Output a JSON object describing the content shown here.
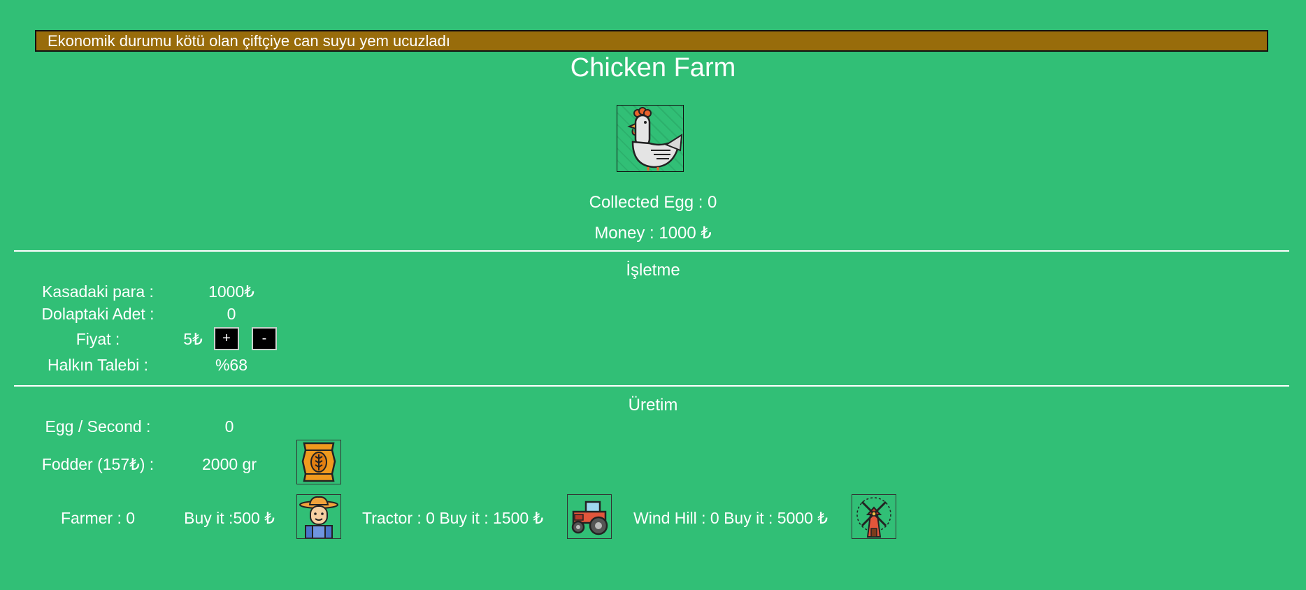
{
  "news_ticker": "Ekonomik durumu kötü olan çiftçiye can suyu yem ucuzladı",
  "title": "Chicken Farm",
  "stats": {
    "collected_egg": "Collected Egg : 0",
    "money": "Money : 1000 ₺"
  },
  "business": {
    "heading": "İşletme",
    "cash_label": "Kasadaki para :",
    "cash_value": "1000₺",
    "stock_label": "Dolaptaki Adet :",
    "stock_value": "0",
    "price_label": "Fiyat :",
    "price_value": "5₺",
    "plus_label": "+",
    "minus_label": "-",
    "demand_label": "Halkın Talebi :",
    "demand_value": "%68"
  },
  "production": {
    "heading": "Üretim",
    "eps_label": "Egg / Second :",
    "eps_value": "0",
    "fodder_label": "Fodder (157₺) :",
    "fodder_value": "2000 gr",
    "farmer_label": "Farmer : 0",
    "farmer_buy": "Buy it :500 ₺",
    "tractor_label": "Tractor : 0 Buy it : 1500 ₺",
    "windhill_label": "Wind Hill : 0 Buy it : 5000 ₺"
  },
  "icons": {
    "chicken": "chicken-icon",
    "fodder": "fodder-bag-icon",
    "farmer": "farmer-icon",
    "tractor": "tractor-icon",
    "windmill": "windmill-icon"
  },
  "colors": {
    "background": "#31bf76",
    "ticker": "#986c0b"
  }
}
